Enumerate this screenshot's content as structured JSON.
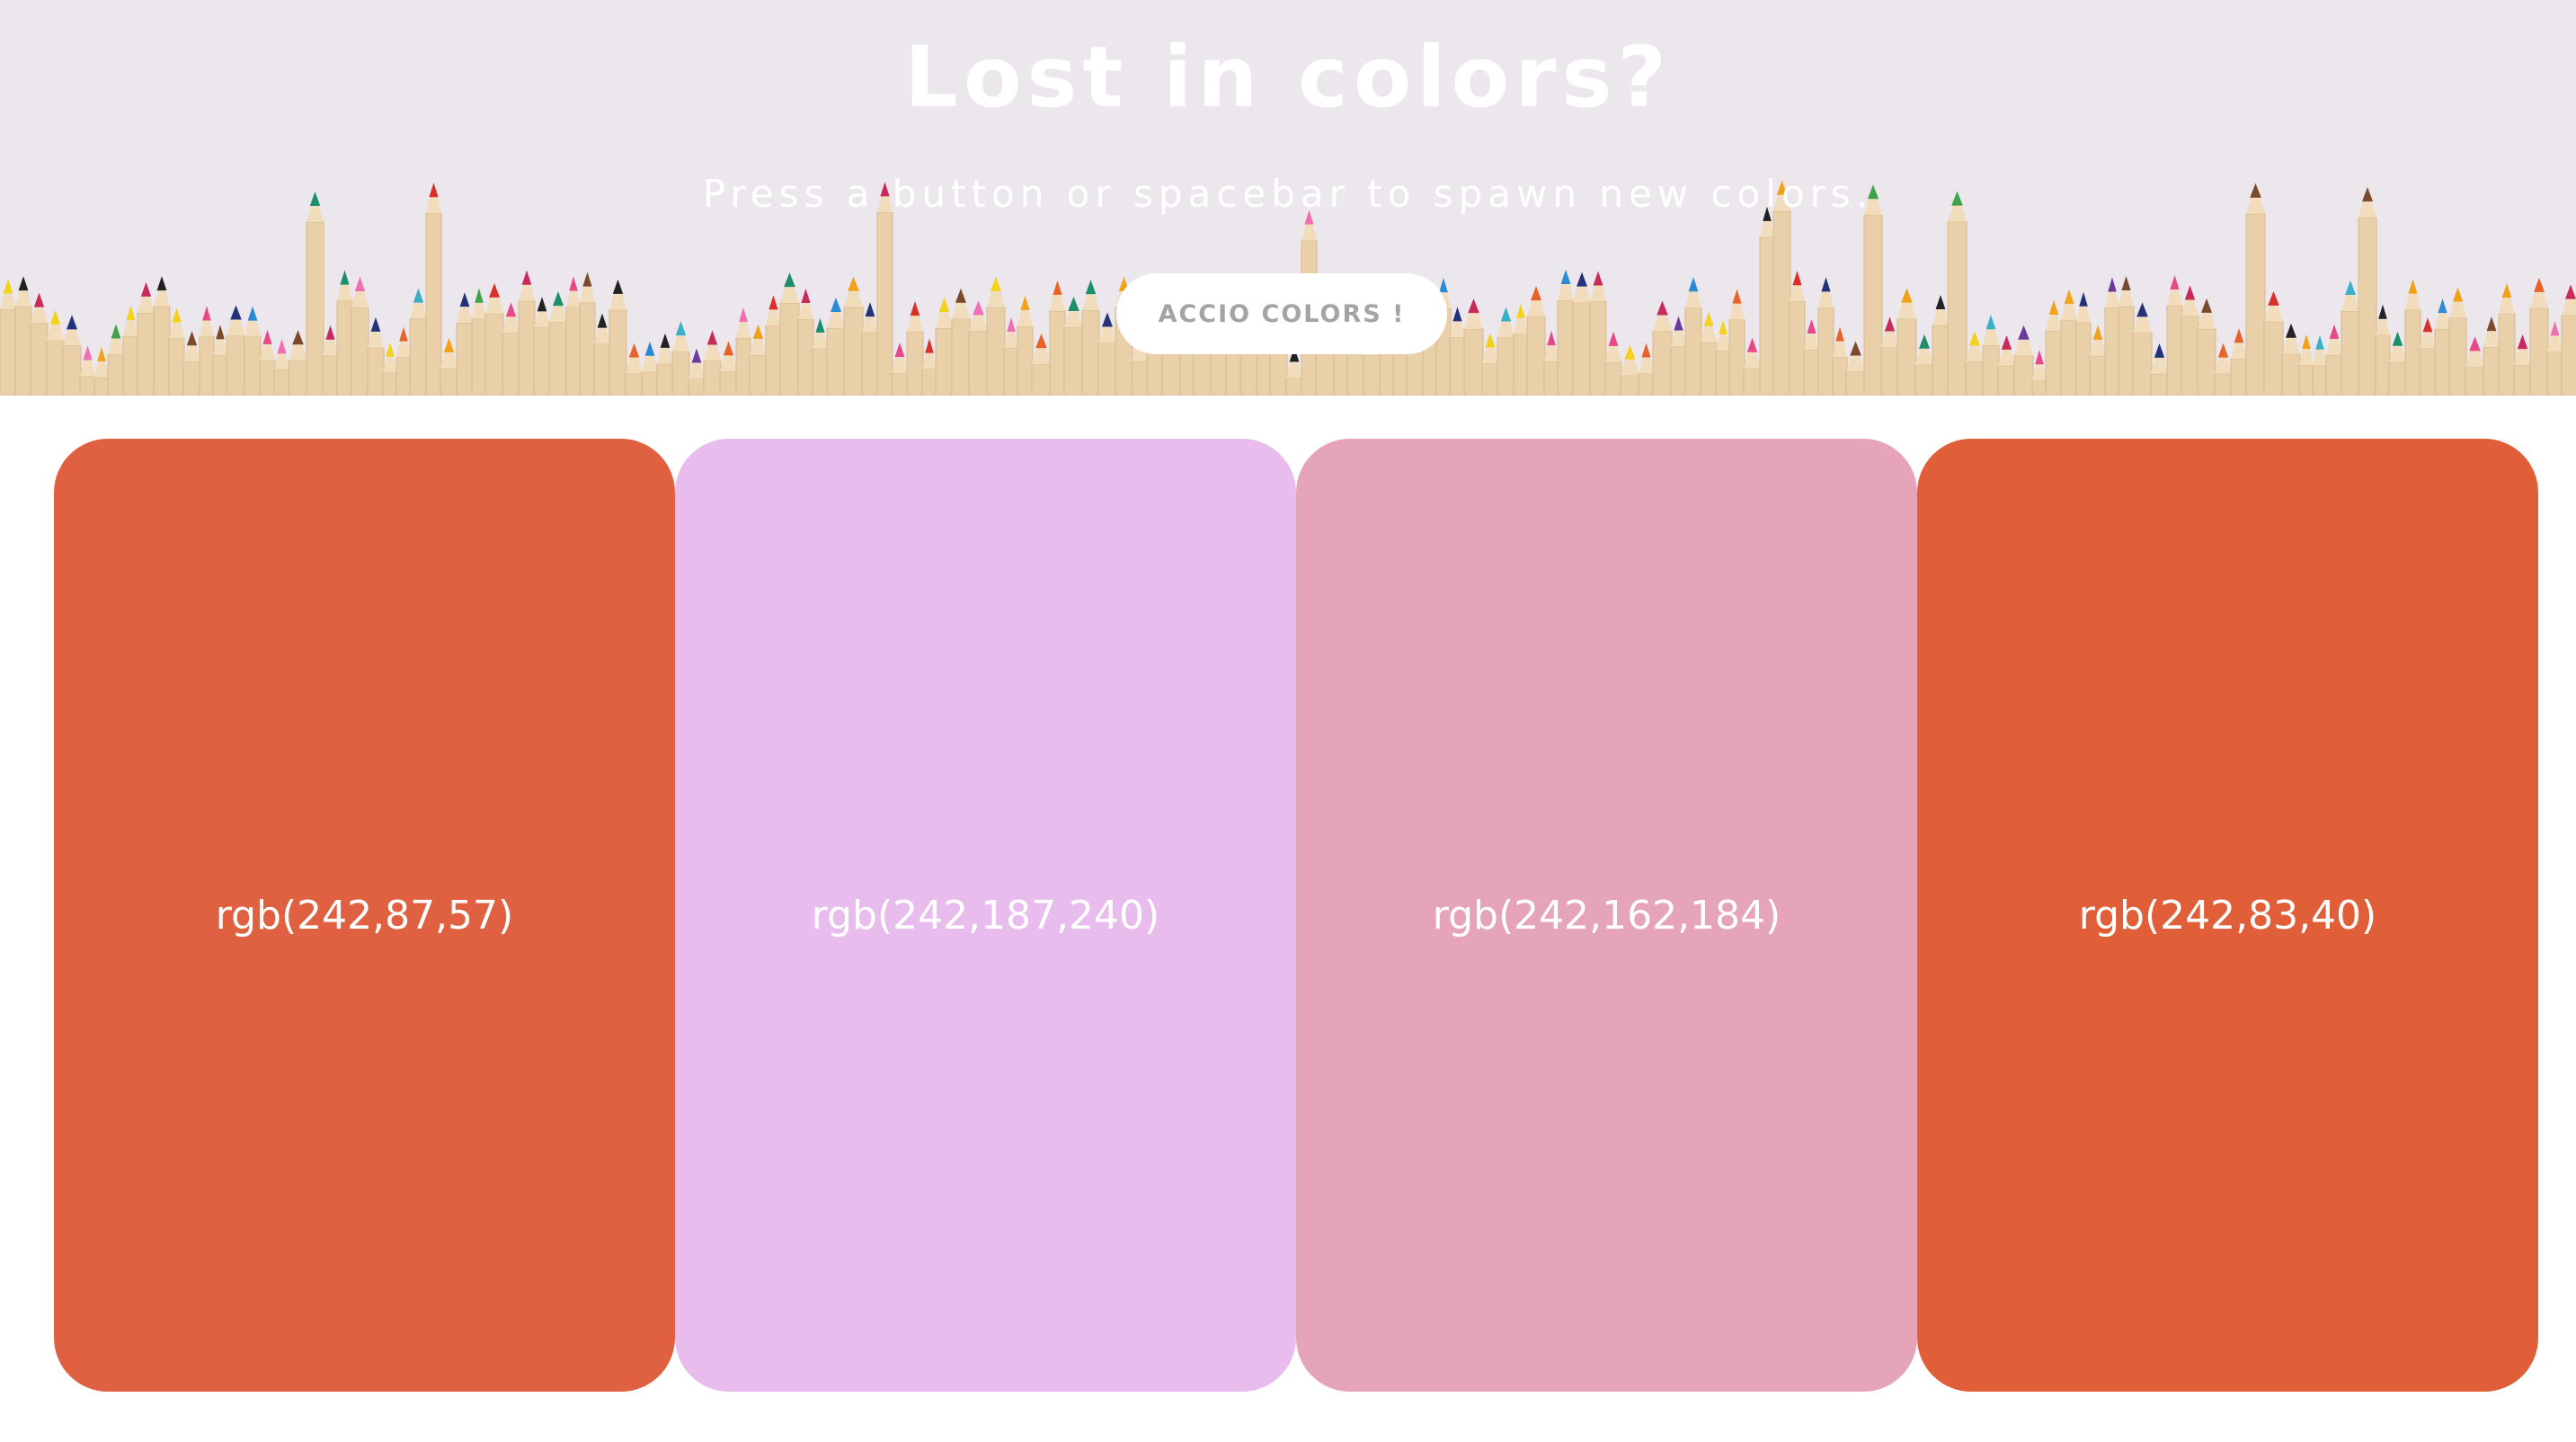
{
  "hero": {
    "title": "Lost in colors?",
    "subtitle": "Press a button or spacebar to spawn new colors.",
    "button_label": "ACCIO COLORS !",
    "background_color": "#ebe7ec",
    "background_image": "colored-pencils-photo"
  },
  "palette": {
    "swatches": [
      {
        "label": "rgb(242,87,57)",
        "color": "#e06042"
      },
      {
        "label": "rgb(242,187,240)",
        "color": "#e8bdee"
      },
      {
        "label": "rgb(242,162,184)",
        "color": "#e6a4b8"
      },
      {
        "label": "rgb(242,83,40)",
        "color": "#e05e38"
      }
    ]
  }
}
